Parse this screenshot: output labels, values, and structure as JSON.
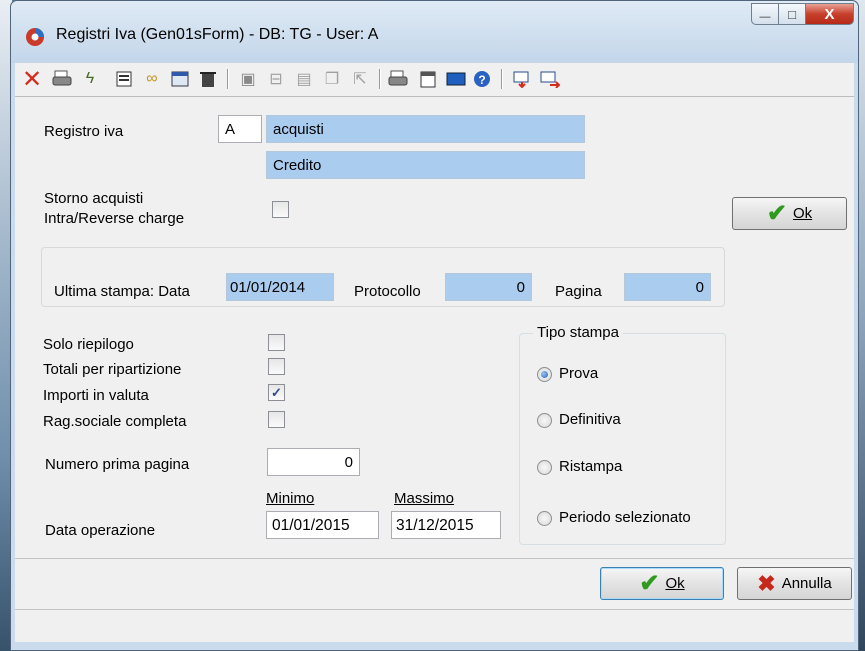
{
  "window": {
    "title": "Registri Iva  (Gen01sForm) - DB: TG - User: A",
    "minimize": "—",
    "maximize": "□",
    "close": "X"
  },
  "toolbar": {
    "icons": [
      "delete-icon",
      "print-icon",
      "lightning-icon",
      "list-icon",
      "glasses-icon",
      "window-icon",
      "trash-icon",
      "folder-icon",
      "sheet-icon",
      "doc-a-icon",
      "copy-icon",
      "export-icon",
      "printer2-icon",
      "calendar-icon",
      "screen-icon",
      "help-icon",
      "record-prev-icon",
      "record-next-icon"
    ]
  },
  "registro": {
    "label": "Registro iva",
    "code": "A",
    "description": "acquisti",
    "type": "Credito"
  },
  "storno": {
    "label_line1": "Storno acquisti",
    "label_line2": "Intra/Reverse charge",
    "checked": false
  },
  "ok_top": {
    "label": "Ok"
  },
  "ultima_stampa": {
    "label": "Ultima stampa: Data",
    "date": "01/01/2014",
    "protocollo_label": "Protocollo",
    "protocollo": "0",
    "pagina_label": "Pagina",
    "pagina": "0"
  },
  "options": {
    "solo_riepilogo": "Solo riepilogo",
    "totali_ripartizione": "Totali per ripartizione",
    "importi_valuta": "Importi in valuta",
    "rag_sociale": "Rag.sociale completa",
    "checked_mark": "✓"
  },
  "numero_prima_pagina": {
    "label": "Numero prima pagina",
    "value": "0"
  },
  "data_operazione": {
    "label": "Data operazione",
    "min_label": "Minimo",
    "max_label": "Massimo",
    "min": "01/01/2015",
    "max": "31/12/2015"
  },
  "tipo_stampa": {
    "legend": "Tipo stampa",
    "options": [
      "Prova",
      "Definitiva",
      "Ristampa",
      "Periodo selezionato"
    ],
    "selected": "Prova"
  },
  "footer": {
    "ok": "Ok",
    "annulla": "Annulla"
  },
  "colors": {
    "field_blue": "#a9ccef",
    "window_frame": "#c9dbed",
    "check_green": "#2f9a1e",
    "cancel_red": "#c8281c"
  }
}
